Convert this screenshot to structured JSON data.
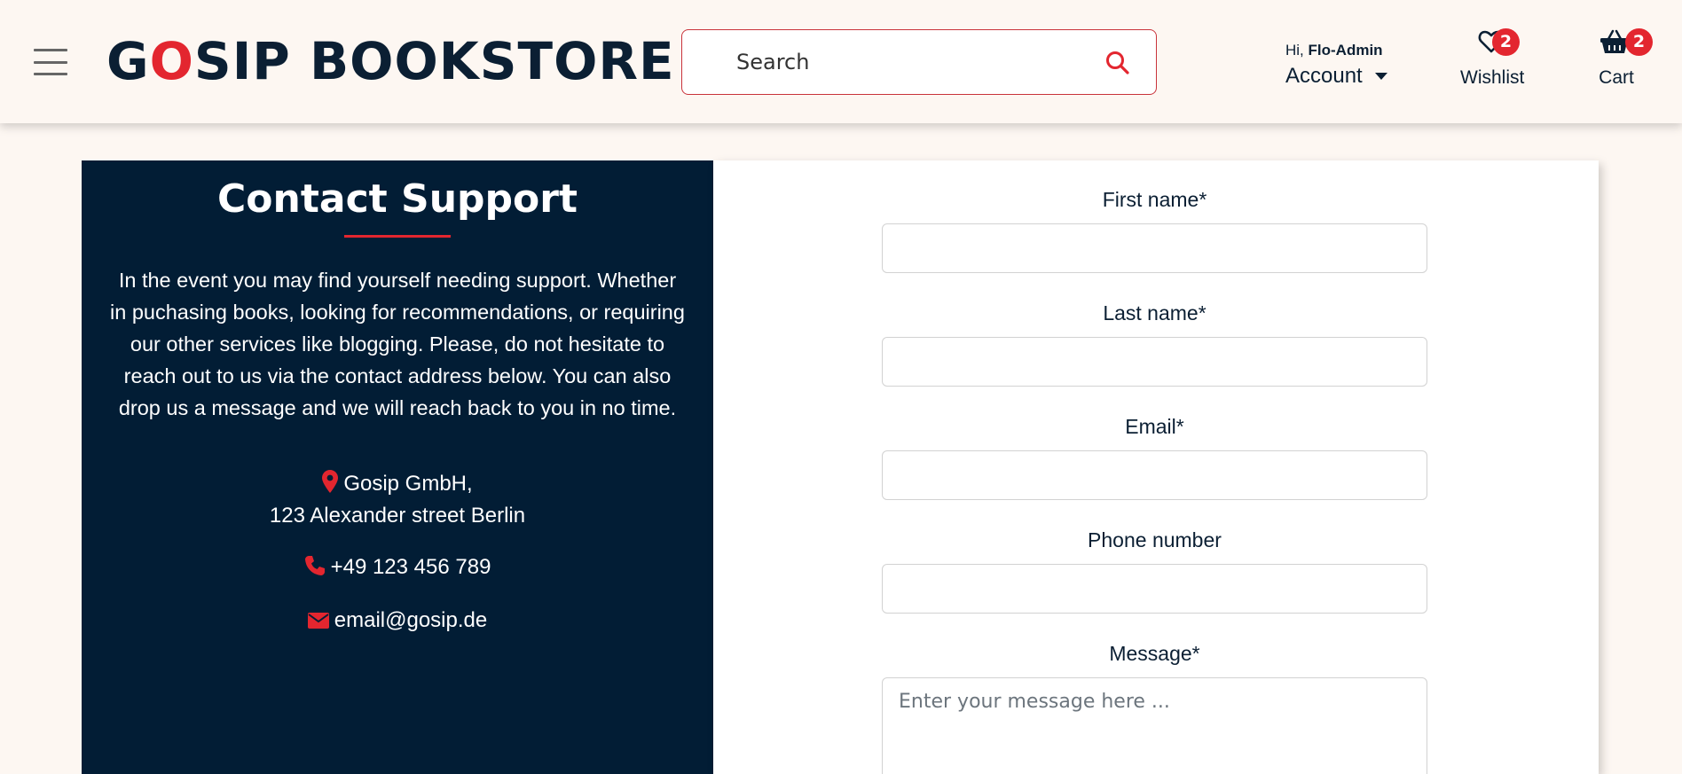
{
  "header": {
    "logo_first": "G",
    "logo_accent": "O",
    "logo_rest": "SIP BOOKSTORE",
    "search_placeholder": "Search",
    "greeting_prefix": "Hi,",
    "user_name": "Flo-Admin",
    "account_label": "Account",
    "wishlist_label": "Wishlist",
    "wishlist_count": "2",
    "cart_label": "Cart",
    "cart_count": "2"
  },
  "contact": {
    "title": "Contact Support",
    "intro": "In the event you may find yourself needing support. Whether in puchasing books, looking for recommendations, or requiring our other services like blogging. Please, do not hesitate to reach out to us via the contact address below. You can also drop us a message and we will reach back to you in no time.",
    "company": "Gosip GmbH,",
    "street": "123 Alexander street Berlin",
    "phone": "+49 123 456 789",
    "email": "email@gosip.de"
  },
  "form": {
    "first_name_label": "First name*",
    "last_name_label": "Last name*",
    "email_label": "Email*",
    "phone_label": "Phone number",
    "message_label": "Message*",
    "message_placeholder": "Enter your message here ..."
  },
  "colors": {
    "accent": "#e3262f",
    "dark": "#021d35",
    "background": "#fdf7f2"
  }
}
